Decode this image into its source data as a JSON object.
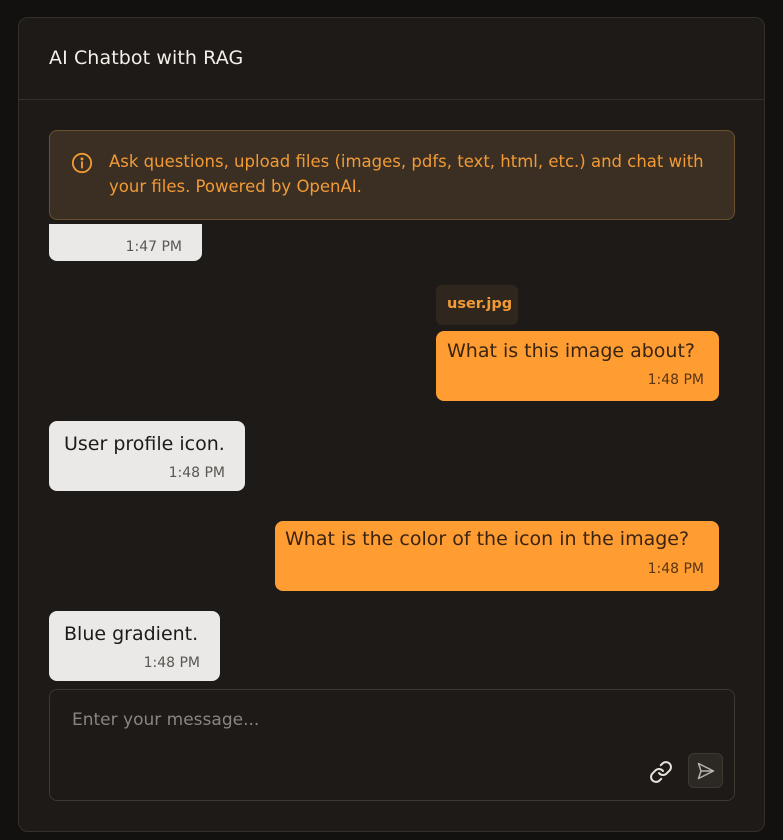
{
  "app": {
    "title": "AI Chatbot with RAG"
  },
  "notice": {
    "icon": "info-icon",
    "text": "Ask questions, upload files (images, pdfs, text, html, etc.) and chat with your files. Powered by OpenAI."
  },
  "messages": [
    {
      "role": "assistant",
      "text": "",
      "time": "1:47 PM"
    },
    {
      "role": "user",
      "attachment": "user.jpg",
      "text": "What is this image about?",
      "time": "1:48 PM"
    },
    {
      "role": "assistant",
      "text": "User profile icon.",
      "time": "1:48 PM"
    },
    {
      "role": "user",
      "text": "What is the color of the icon in the image?",
      "time": "1:48 PM"
    },
    {
      "role": "assistant",
      "text": "Blue gradient.",
      "time": "1:48 PM"
    }
  ],
  "composer": {
    "placeholder": "Enter your message...",
    "attach_icon": "link-icon",
    "send_icon": "send-icon"
  },
  "colors": {
    "accent": "#ff9d33",
    "background": "#1d1a17",
    "bot_bubble": "#ebe9e7",
    "notice_text": "#f29a36"
  }
}
